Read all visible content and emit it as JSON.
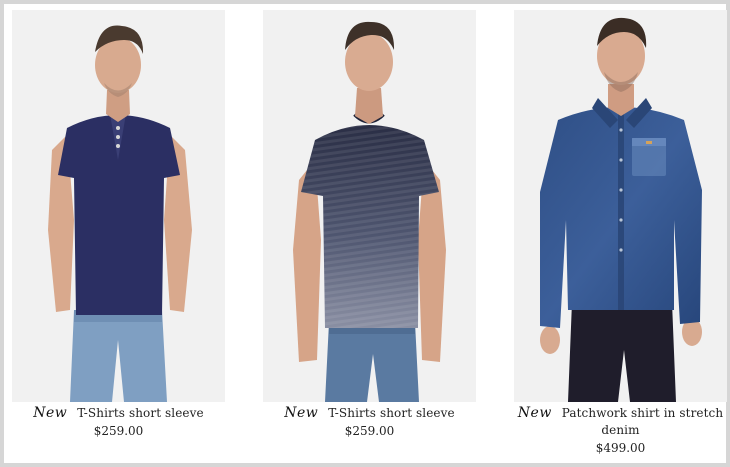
{
  "products": [
    {
      "badge": "New",
      "title": "T-Shirts short sleeve",
      "price": "$259.00",
      "shirt_color": "#2b2f63",
      "image_alt": "Man wearing navy henley t-shirt and light jeans"
    },
    {
      "badge": "New",
      "title": "T-Shirts short sleeve",
      "price": "$259.00",
      "shirt_color": "#5a5f73",
      "image_alt": "Man wearing grey striped gradient t-shirt and jeans"
    },
    {
      "badge": "New",
      "title": "Patchwork shirt in stretch denim",
      "price": "$499.00",
      "shirt_color": "#3c5a8f",
      "image_alt": "Man wearing denim shirt with pocket and dark jeans"
    }
  ],
  "colors": {
    "frame": "#d6d6d6",
    "photo_bg": "#f1f1f1",
    "text": "#222222"
  }
}
